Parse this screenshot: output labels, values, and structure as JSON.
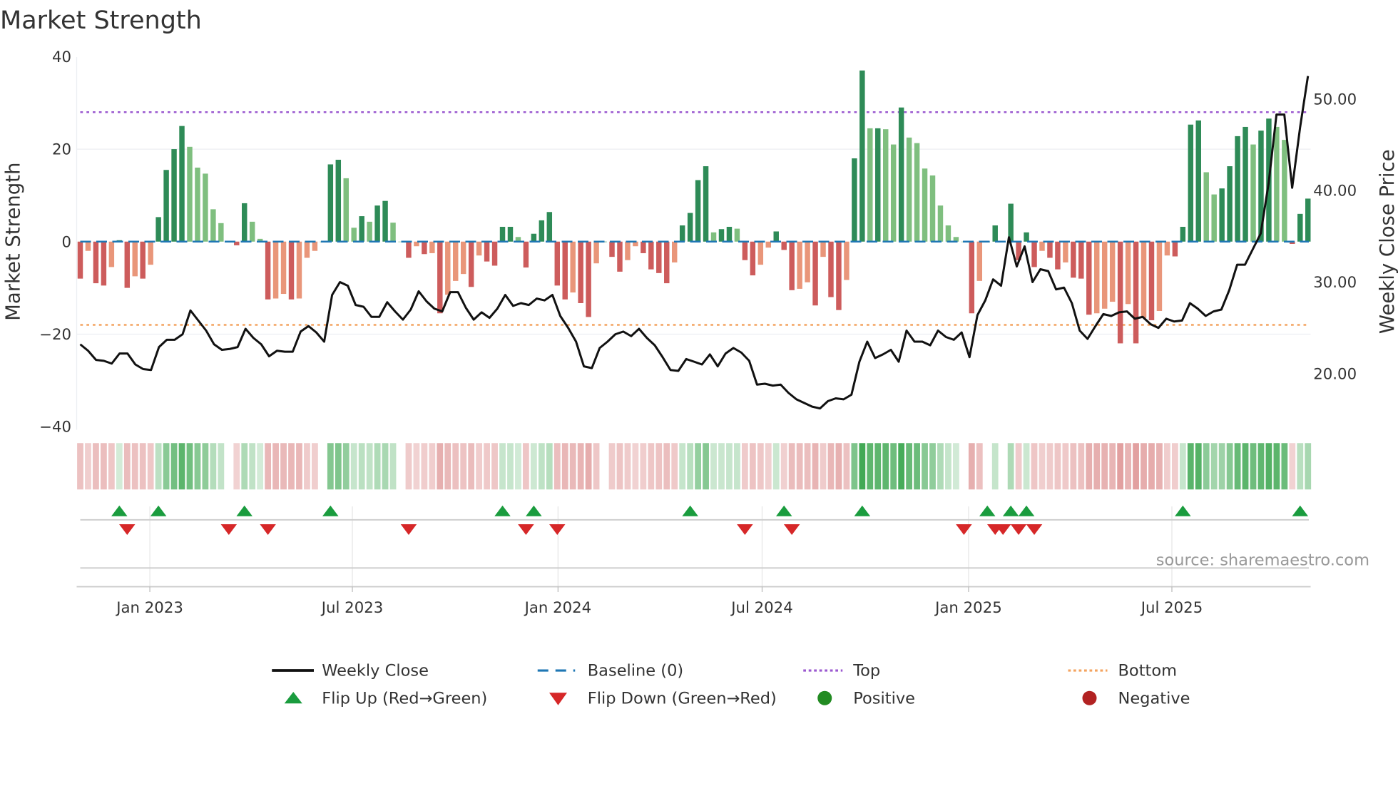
{
  "title": "Market Strength",
  "source": "source: sharemaestro.com",
  "colors": {
    "pos_dark": "#2e8b57",
    "pos_light": "#7fbf7f",
    "neg_dark": "#cd5c5c",
    "neg_light": "#e9967a",
    "baseline": "#1f77b4",
    "top": "#9b59d0",
    "bottom": "#f4a460",
    "line": "#111111",
    "flip_up": "#1a9c3e",
    "flip_down": "#d62728",
    "positive": "#228b22",
    "negative": "#b22222"
  },
  "chart_data": {
    "type": "bar",
    "title": "Market Strength",
    "frequency": "weekly",
    "ylabel": "Market Strength",
    "y2label": "Weekly Close Price",
    "ylim": [
      -40,
      40
    ],
    "y2lim": [
      14,
      55
    ],
    "yticks": [
      "40",
      "20",
      "0",
      "−20",
      "−40"
    ],
    "yticks_values": [
      40,
      20,
      0,
      -20,
      -40
    ],
    "y2ticks": [
      "50.00",
      "40.00",
      "30.00",
      "20.00"
    ],
    "y2ticks_values": [
      50,
      40,
      30,
      20
    ],
    "xticks": [
      "Jan 2023",
      "Jul 2023",
      "Jan 2024",
      "Jul 2024",
      "Jan 2025",
      "Jul 2025"
    ],
    "xticks_week_index": [
      8.9,
      34.8,
      61.1,
      87.2,
      113.6,
      139.6
    ],
    "top_level": 28,
    "bottom_level": -18,
    "baseline": 0,
    "strength": [
      -8,
      -2,
      -9,
      -9.5,
      -5.5,
      0.3,
      -10,
      -7.5,
      -8,
      -5,
      5.3,
      15.5,
      20,
      25,
      20.5,
      16,
      14.7,
      7,
      4,
      0,
      -0.8,
      8.3,
      4.3,
      0.6,
      -12.5,
      -12.3,
      -11.3,
      -12.5,
      -12.3,
      -3.5,
      -2,
      0,
      16.7,
      17.7,
      13.7,
      3,
      5.5,
      4.3,
      7.8,
      8.8,
      4.1,
      0,
      -3.5,
      -1,
      -2.7,
      -2.5,
      -15.5,
      -11.5,
      -8.5,
      -7,
      -9.8,
      -3,
      -4.3,
      -5.2,
      3.2,
      3.2,
      1,
      -5.6,
      1.7,
      4.6,
      6.4,
      -9.5,
      -12.5,
      -11,
      -13.3,
      -16.3,
      -4.7,
      0,
      -3.3,
      -6.5,
      -4,
      -1,
      -2.5,
      -6,
      -6.8,
      -9,
      -4.5,
      3.5,
      6.2,
      13.3,
      16.3,
      2,
      2.7,
      3.2,
      2.8,
      -4,
      -7.3,
      -5,
      -1.3,
      2.2,
      -1.8,
      -10.5,
      -10.2,
      -8.8,
      -13.8,
      -3.3,
      -12,
      -14.8,
      -8.3,
      18,
      37,
      24.5,
      24.5,
      24.3,
      21,
      29,
      22.5,
      21.3,
      15.8,
      14.3,
      7.8,
      3.5,
      1,
      0,
      -15.5,
      -8.5,
      0,
      3.5,
      0,
      8.2,
      -4,
      2,
      -5.5,
      -2,
      -3.5,
      -6,
      -4.5,
      -7.8,
      -8,
      -15.8,
      -15.5,
      -14.5,
      -13,
      -22,
      -13.5,
      -22,
      -16.5,
      -17,
      -15,
      -3,
      -3.2,
      3.2,
      25.3,
      26.2,
      15,
      10.2,
      11.5,
      16.3,
      22.8,
      24.8,
      21,
      24,
      26.6,
      24.8,
      22,
      -0.5,
      6,
      9.3
    ],
    "weekly_close": [
      23.2,
      22.5,
      21.5,
      21.4,
      21.1,
      22.2,
      22.2,
      21.0,
      20.5,
      20.4,
      22.9,
      23.7,
      23.7,
      24.3,
      26.9,
      25.8,
      24.7,
      23.2,
      22.6,
      22.7,
      22.9,
      24.9,
      23.9,
      23.2,
      21.9,
      22.5,
      22.4,
      22.4,
      24.6,
      25.2,
      24.5,
      23.5,
      28.6,
      30.0,
      29.6,
      27.5,
      27.3,
      26.2,
      26.2,
      27.8,
      26.8,
      25.9,
      27.0,
      29.0,
      27.9,
      27.1,
      26.8,
      28.9,
      28.9,
      27.2,
      25.9,
      26.7,
      26.1,
      27.1,
      28.6,
      27.4,
      27.7,
      27.5,
      28.2,
      28.0,
      28.6,
      26.3,
      25.0,
      23.5,
      20.8,
      20.6,
      22.8,
      23.5,
      24.3,
      24.6,
      24.1,
      24.9,
      23.9,
      23.1,
      21.8,
      20.4,
      20.3,
      21.6,
      21.3,
      21.0,
      22.1,
      20.8,
      22.2,
      22.8,
      22.3,
      21.4,
      18.8,
      18.9,
      18.7,
      18.8,
      17.9,
      17.2,
      16.8,
      16.4,
      16.2,
      17.0,
      17.3,
      17.2,
      17.7,
      21.3,
      23.5,
      21.7,
      22.1,
      22.6,
      21.3,
      24.7,
      23.5,
      23.5,
      23.1,
      24.7,
      24.0,
      23.7,
      24.5,
      21.8,
      26.4,
      28.0,
      30.3,
      29.6,
      34.9,
      31.7,
      33.9,
      30.0,
      31.4,
      31.2,
      29.2,
      29.4,
      27.7,
      24.7,
      23.8,
      25.2,
      26.5,
      26.3,
      26.7,
      26.8,
      26.0,
      26.2,
      25.4,
      25.0,
      26.0,
      25.7,
      25.8,
      27.7,
      27.1,
      26.3,
      26.8,
      27.0,
      29.1,
      31.9,
      31.9,
      33.6,
      35.3,
      40.8,
      48.3,
      48.3,
      40.3,
      46.9,
      52.5
    ],
    "flip_up_week_index": [
      5,
      10,
      21,
      32,
      54,
      58,
      78,
      90,
      100,
      116,
      119,
      121,
      141,
      156
    ],
    "flip_down_week_index": [
      6,
      19,
      24,
      42,
      57,
      61,
      85,
      91,
      113,
      117,
      118,
      120,
      122
    ],
    "legend": {
      "placement": "bottom",
      "items": [
        {
          "key": "line",
          "label": "Weekly Close"
        },
        {
          "key": "baseline",
          "label": "Baseline (0)"
        },
        {
          "key": "top",
          "label": "Top"
        },
        {
          "key": "bottom",
          "label": "Bottom"
        },
        {
          "key": "flip_up",
          "label": "Flip Up (Red→Green)"
        },
        {
          "key": "flip_down",
          "label": "Flip Down (Green→Red)"
        },
        {
          "key": "positive",
          "label": "Positive"
        },
        {
          "key": "negative",
          "label": "Negative"
        }
      ]
    }
  }
}
